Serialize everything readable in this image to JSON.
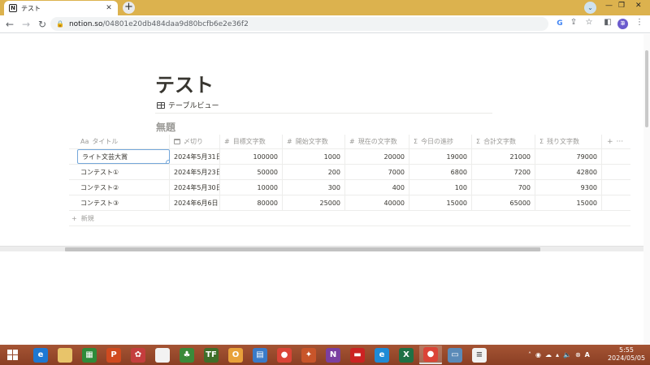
{
  "browser": {
    "tab_title": "テスト",
    "tab_favicon": "N",
    "url_host": "notion.so",
    "url_path": "/04801e20db484daa9d80bcfb6e2e36f2",
    "avatar_text": "筆",
    "accent": "#dcb24e"
  },
  "notion": {
    "page_title": "テスト",
    "view_label": "テーブルビュー",
    "database_title": "無題",
    "columns": [
      {
        "icon": "Aa",
        "label": "タイトル"
      },
      {
        "icon": "cal",
        "label": "〆切り"
      },
      {
        "icon": "#",
        "label": "目標文字数"
      },
      {
        "icon": "#",
        "label": "開始文字数"
      },
      {
        "icon": "#",
        "label": "現在の文字数"
      },
      {
        "icon": "Σ",
        "label": "今日の進捗"
      },
      {
        "icon": "Σ",
        "label": "合計文字数"
      },
      {
        "icon": "Σ",
        "label": "残り文字数"
      }
    ],
    "rows": [
      [
        "ライト文芸大賞",
        "2024年5月31日",
        "100000",
        "1000",
        "20000",
        "19000",
        "21000",
        "79000"
      ],
      [
        "コンテスト①",
        "2024年5月23日",
        "50000",
        "200",
        "7000",
        "6800",
        "7200",
        "42800"
      ],
      [
        "コンテスト②",
        "2024年5月30日",
        "10000",
        "300",
        "400",
        "100",
        "700",
        "9300"
      ],
      [
        "コンテスト③",
        "2024年6月6日",
        "80000",
        "25000",
        "40000",
        "15000",
        "65000",
        "15000"
      ]
    ],
    "add_column": "+",
    "more": "···",
    "new_row_label": "新規"
  },
  "taskbar": {
    "apps": [
      {
        "name": "edge-legacy",
        "glyph": "e",
        "color": "#1e78d2"
      },
      {
        "name": "file-explorer",
        "glyph": "",
        "color": "#e8c46a"
      },
      {
        "name": "store",
        "glyph": "▦",
        "color": "#2e8b3a"
      },
      {
        "name": "powerpoint-like",
        "glyph": "P",
        "color": "#d04a1f"
      },
      {
        "name": "game",
        "glyph": "✿",
        "color": "#c43d3d"
      },
      {
        "name": "document",
        "glyph": "",
        "color": "#f2f2f2"
      },
      {
        "name": "game-2",
        "glyph": "♣",
        "color": "#3a8a3a"
      },
      {
        "name": "app-tf",
        "glyph": "TF",
        "color": "#3f6e2a"
      },
      {
        "name": "outlook",
        "glyph": "O",
        "color": "#e8a13a"
      },
      {
        "name": "photos",
        "glyph": "▤",
        "color": "#3a7bc8"
      },
      {
        "name": "chrome",
        "glyph": "●",
        "color": "#db4437"
      },
      {
        "name": "app-swirl",
        "glyph": "✦",
        "color": "#c8552a"
      },
      {
        "name": "onenote",
        "glyph": "N",
        "color": "#7b3fa0"
      },
      {
        "name": "app-red",
        "glyph": "▬",
        "color": "#cc2222"
      },
      {
        "name": "edge",
        "glyph": "e",
        "color": "#1f8bd6"
      },
      {
        "name": "excel",
        "glyph": "X",
        "color": "#1e7145"
      },
      {
        "name": "chrome-active",
        "glyph": "●",
        "color": "#db4437"
      },
      {
        "name": "monitor",
        "glyph": "▭",
        "color": "#5a8ab8"
      },
      {
        "name": "notepad",
        "glyph": "≡",
        "color": "#f2f2f2"
      }
    ],
    "time": "5:55",
    "date": "2024/05/05",
    "tray_label": "A"
  }
}
